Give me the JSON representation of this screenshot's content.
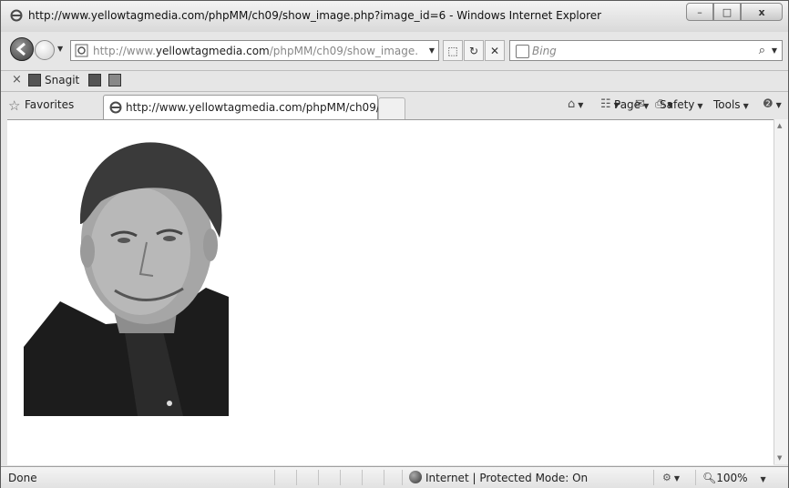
{
  "window": {
    "title": "http://www.yellowtagmedia.com/phpMM/ch09/show_image.php?image_id=6 - Windows Internet Explorer",
    "minimize_glyph": "–",
    "maximize_glyph": "□",
    "close_glyph": "x"
  },
  "nav": {
    "address_prefix": "http://www.",
    "address_domain": "yellowtagmedia.com",
    "address_suffix": "/phpMM/ch09/show_image.",
    "search_placeholder": "Bing",
    "search_go_glyph": "⌕",
    "refresh_glyph": "↻",
    "stop_glyph": "✕",
    "compat_glyph": "⬚"
  },
  "toolbar": {
    "close_glyph": "×",
    "snagit_label": "Snagit"
  },
  "favorites": {
    "label": "Favorites"
  },
  "tab": {
    "label": "http://www.yellowtagmedia.com/phpMM/ch09/..."
  },
  "commandbar": {
    "page": "Page",
    "safety": "Safety",
    "tools": "Tools"
  },
  "status": {
    "text": "Done",
    "zone": "Internet | Protected Mode: On",
    "zoom": "100%"
  },
  "icons": {
    "home": "home-icon",
    "feeds": "feeds-icon",
    "mail": "read-mail-icon",
    "print": "print-icon",
    "help": "help-icon"
  },
  "colors": {
    "titlebar": "#e4e4e4",
    "content_bg": "#ffffff"
  }
}
